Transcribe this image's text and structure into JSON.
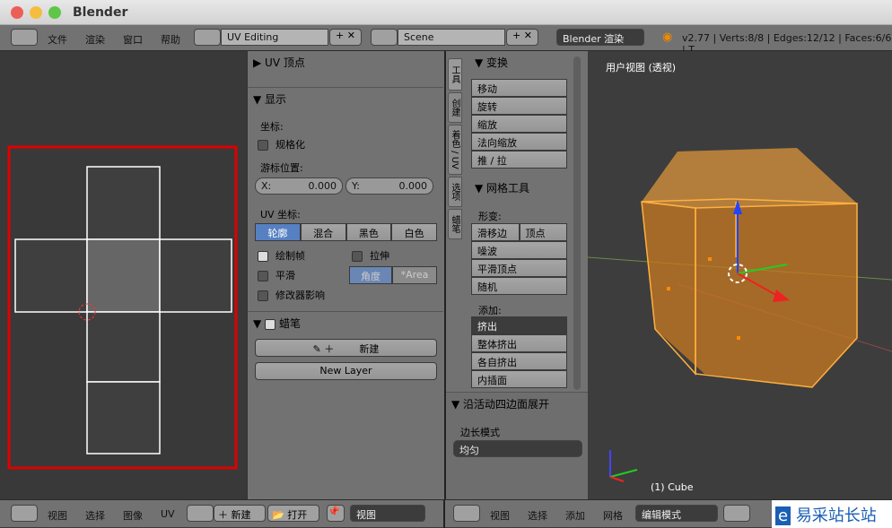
{
  "window": {
    "title": "Blender"
  },
  "topbar": {
    "menus": [
      "文件",
      "渲染",
      "窗口",
      "帮助"
    ],
    "layout": "UV Editing",
    "scene": "Scene",
    "engine": "Blender 渲染",
    "stats": "v2.77 | Verts:8/8 | Edges:12/12 | Faces:6/6 | T"
  },
  "props": {
    "uv_vertex": "UV 顶点",
    "display": "显示",
    "coords": "坐标:",
    "normalized": "规格化",
    "cursor": "游标位置:",
    "x_label": "X:",
    "x_val": "0.000",
    "y_label": "Y:",
    "y_val": "0.000",
    "uv_coords": "UV 坐标:",
    "modes": [
      "轮廓",
      "混合",
      "黑色",
      "白色"
    ],
    "draw_frame": "绘制帧",
    "stretch": "拉伸",
    "smooth": "平滑",
    "angle": "角度",
    "area": "*Area",
    "modifier": "修改器影响",
    "grease": "蜡笔",
    "new": "新建",
    "new_layer": "New Layer"
  },
  "tools": {
    "tabs": [
      "工具",
      "创建",
      "着色 / UV",
      "选项",
      "蜡笔"
    ],
    "transform": "变换",
    "transform_items": [
      "移动",
      "旋转",
      "缩放",
      "法向缩放",
      "推 / 拉"
    ],
    "mesh_tools": "网格工具",
    "deform": "形变:",
    "slide_edge": "滑移边",
    "vertex": "顶点",
    "deform_items": [
      "噪波",
      "平滑顶点",
      "随机"
    ],
    "add": "添加:",
    "extrude": "挤出",
    "add_items": [
      "整体挤出",
      "各自挤出",
      "内插面"
    ],
    "op_title": "沿活动四边面展开",
    "edge_mode": "边长模式",
    "edge_val": "均匀"
  },
  "viewport": {
    "label": "用户视图 (透视)",
    "object": "(1) Cube"
  },
  "bottom": {
    "uv_menus": [
      "视图",
      "选择",
      "图像",
      "UV"
    ],
    "new": "新建",
    "open": "打开",
    "view": "视图",
    "v3d_menus": [
      "视图",
      "选择",
      "添加",
      "网格"
    ],
    "mode": "编辑模式"
  },
  "watermark": {
    "text": "易采站长站"
  },
  "colors": {
    "accent": "#5680c2",
    "selection": "#ff8c00",
    "highlight_box": "#e00000"
  }
}
